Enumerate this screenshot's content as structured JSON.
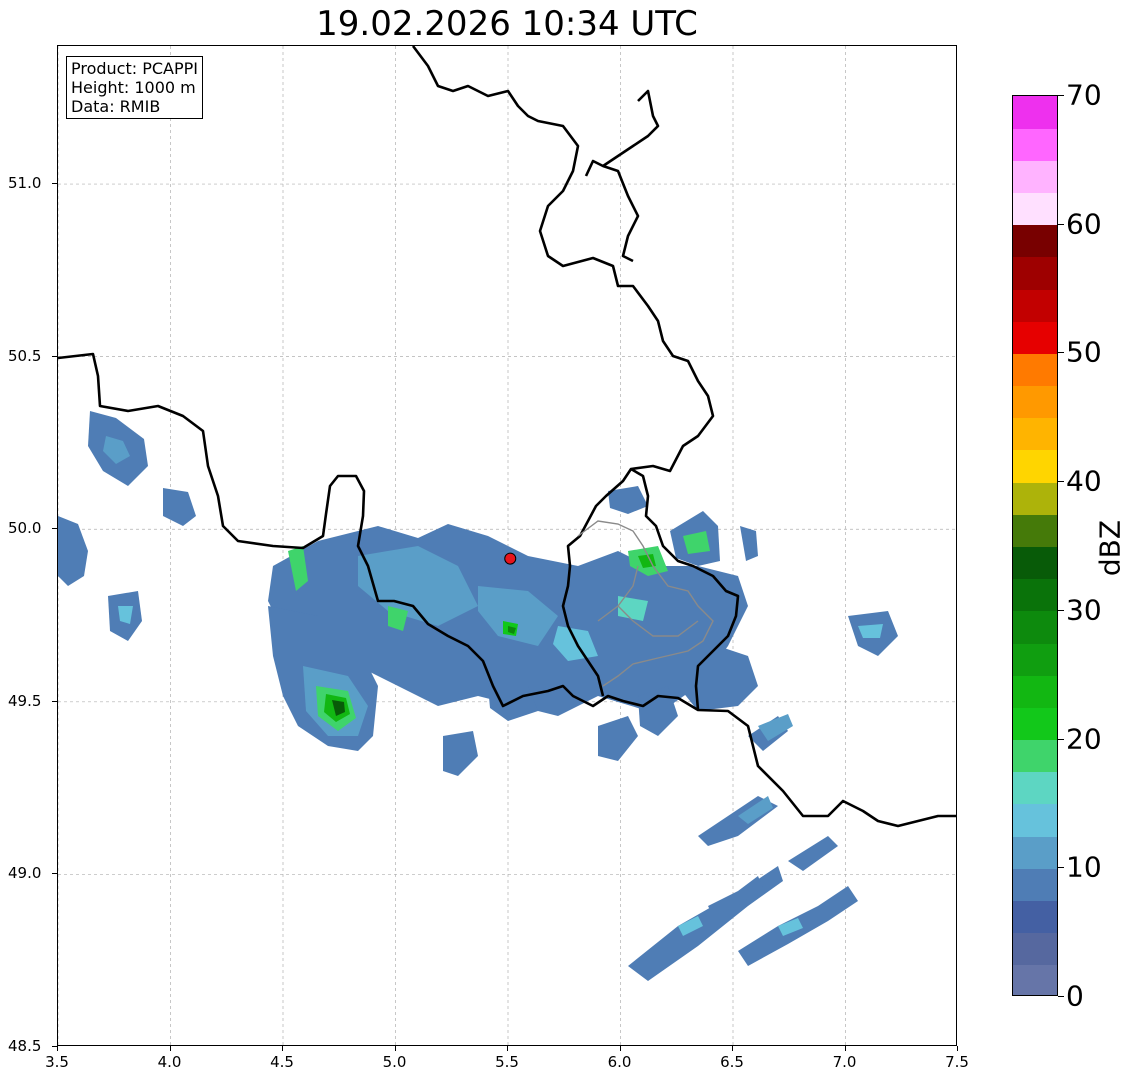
{
  "title": "19.02.2026 10:34 UTC",
  "info": {
    "product": "Product: PCAPPI",
    "height": "Height: 1000 m",
    "data": "Data: RMIB"
  },
  "axes": {
    "xlim": [
      3.5,
      7.5
    ],
    "ylim": [
      48.5,
      51.4
    ],
    "x_ticks": [
      "3.5",
      "4.0",
      "4.5",
      "5.0",
      "5.5",
      "6.0",
      "6.5",
      "7.0",
      "7.5"
    ],
    "y_ticks": [
      "48.5",
      "49.0",
      "49.5",
      "50.0",
      "50.5",
      "51.0"
    ],
    "grid": true
  },
  "radar_site": {
    "lon": 5.51,
    "lat": 49.915,
    "color": "#e8141c"
  },
  "colorbar": {
    "label": "dBZ",
    "ticks": [
      "0",
      "10",
      "20",
      "30",
      "40",
      "50",
      "60",
      "70"
    ],
    "colors": [
      "#6675a8",
      "#56689f",
      "#4460a3",
      "#4f7db5",
      "#5a9ec8",
      "#66c2dc",
      "#5dd6c2",
      "#3fd46b",
      "#12c81a",
      "#12b712",
      "#109e10",
      "#0d8a0d",
      "#0a730a",
      "#085b08",
      "#457a09",
      "#adb30a",
      "#ffd500",
      "#ffb400",
      "#ff9900",
      "#ff7a00",
      "#e60000",
      "#c20000",
      "#9e0000",
      "#780000",
      "#ffe0ff",
      "#ffb3ff",
      "#ff66ff",
      "#ee30ee"
    ]
  }
}
